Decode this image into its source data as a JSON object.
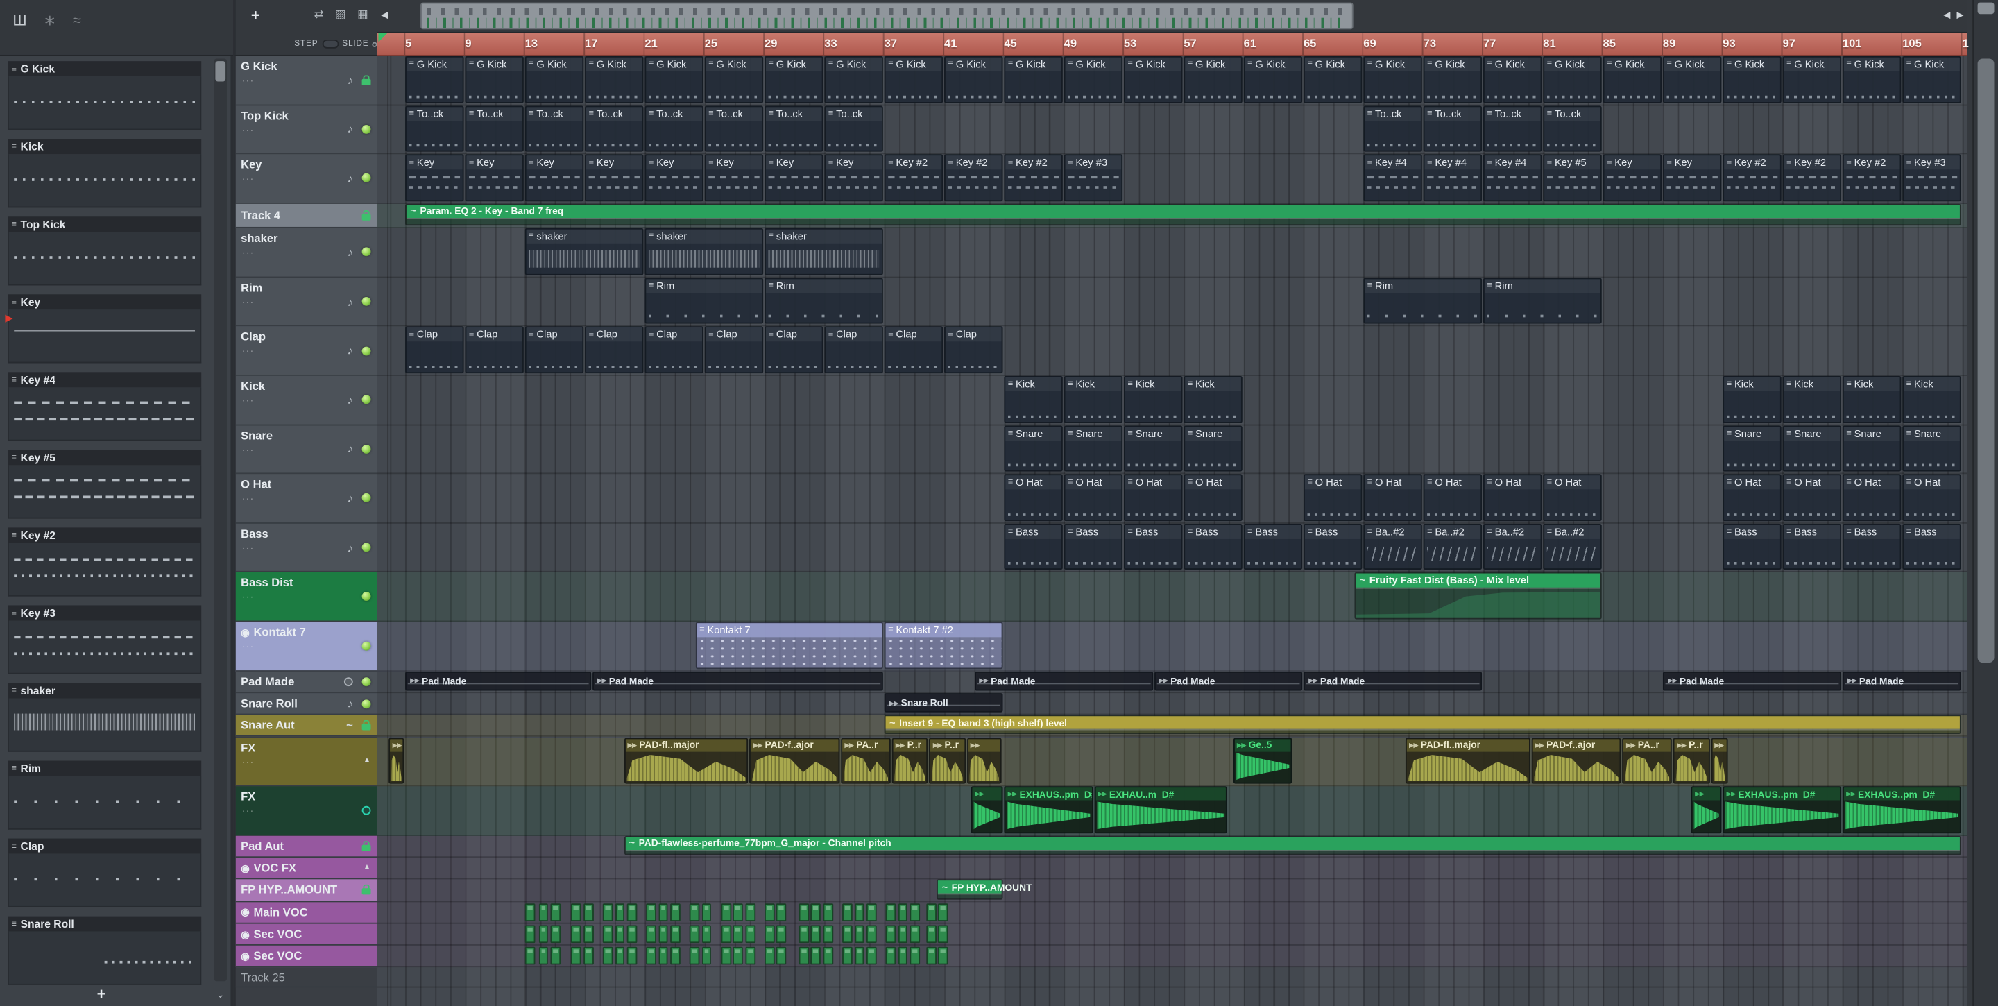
{
  "colors": {
    "row_green_bg": "#1c7c42",
    "row_lavender_bg": "#9ba1cc",
    "row_olive_bg": "#8a8238",
    "row_olive2_bg": "#6f692c",
    "row_darkgreen_bg": "#1d4130",
    "row_purple_bg": "#96589f",
    "row_purple_light_bg": "#a977b5",
    "ruler_bg": "#bc6a5f",
    "auto_green": "#2aa25d",
    "auto_olive": "#b1a33e",
    "audio_olive_wave": "#a8a84e",
    "audio_green_text": "#49e37f",
    "audio_green_wave": "#35c368",
    "led_green": "#8fd14f",
    "playhead_red": "#e0392e"
  },
  "toolbar": {
    "icons": [
      {
        "name": "playlist-grid-icon",
        "glyph": "Ш"
      },
      {
        "name": "snap-magnet-icon",
        "glyph": "∗"
      },
      {
        "name": "slide-tool-icon",
        "glyph": "≈"
      }
    ]
  },
  "panel_header": {
    "add_label": "+",
    "step_label": "STEP",
    "slide_label": "SLIDE",
    "icons": [
      {
        "name": "swap-tracks-icon",
        "glyph": "⇄"
      },
      {
        "name": "paint-tool-icon",
        "glyph": "▨"
      },
      {
        "name": "piano-view-icon",
        "glyph": "▦"
      }
    ]
  },
  "pattern_sidebar": {
    "add_label": "+",
    "patterns": [
      {
        "name": "G Kick",
        "preview": "steps"
      },
      {
        "name": "Kick",
        "preview": "steps"
      },
      {
        "name": "Top Kick",
        "preview": "steps"
      },
      {
        "name": "Key",
        "preview": "line",
        "playing": true
      },
      {
        "name": "Key #4",
        "preview": "notes"
      },
      {
        "name": "Key #5",
        "preview": "notes"
      },
      {
        "name": "Key #2",
        "preview": "notes2"
      },
      {
        "name": "Key #3",
        "preview": "notes2"
      },
      {
        "name": "shaker",
        "preview": "wave"
      },
      {
        "name": "Rim",
        "preview": "sparse"
      },
      {
        "name": "Clap",
        "preview": "sparse"
      },
      {
        "name": "Snare Roll",
        "preview": "endsteps"
      }
    ]
  },
  "track_panel": {
    "tracks": [
      {
        "name": "G Kick",
        "size": "std",
        "icons": [
          "note",
          "lock"
        ]
      },
      {
        "name": "Top Kick",
        "size": "std",
        "icons": [
          "note",
          "led"
        ]
      },
      {
        "name": "Key",
        "size": "std",
        "icons": [
          "note",
          "led"
        ]
      },
      {
        "name": "Track 4",
        "size": "sel",
        "selected": true,
        "icons": [
          "lock"
        ]
      },
      {
        "name": "shaker",
        "size": "std",
        "icons": [
          "note",
          "led"
        ]
      },
      {
        "name": "Rim",
        "size": "std",
        "icons": [
          "note",
          "led"
        ]
      },
      {
        "name": "Clap",
        "size": "std",
        "icons": [
          "note",
          "led"
        ]
      },
      {
        "name": "Kick",
        "size": "std",
        "icons": [
          "note",
          "led"
        ]
      },
      {
        "name": "Snare",
        "size": "std",
        "icons": [
          "note",
          "led"
        ]
      },
      {
        "name": "O Hat",
        "size": "std",
        "icons": [
          "note",
          "led"
        ]
      },
      {
        "name": "Bass",
        "size": "std",
        "icons": [
          "note",
          "led"
        ]
      },
      {
        "name": "Bass Dist",
        "size": "std",
        "bg": "green",
        "icons": [
          "led"
        ]
      },
      {
        "name": "Kontakt 7",
        "size": "std",
        "bg": "lavender",
        "prefix": "◉",
        "icons": [
          "led"
        ]
      },
      {
        "name": "Pad Made",
        "size": "thin",
        "icons": [
          "knob",
          "led"
        ]
      },
      {
        "name": "Snare Roll",
        "size": "thin",
        "icons": [
          "note",
          "led"
        ]
      },
      {
        "name": "Snare Aut",
        "size": "thin",
        "bg": "olive",
        "icons": [
          "link",
          "lock"
        ]
      },
      {
        "name": "FX",
        "size": "std",
        "bg": "olive2",
        "icons": [
          "tri"
        ]
      },
      {
        "name": "FX",
        "size": "std",
        "bg": "darkgreen",
        "icons": [
          "knob2"
        ]
      },
      {
        "name": "Pad Aut",
        "size": "thin",
        "bg": "purple",
        "icons": [
          "lock"
        ]
      },
      {
        "name": "VOC FX",
        "size": "thin",
        "bg": "purple",
        "prefix": "◉",
        "icons": [
          "tri"
        ]
      },
      {
        "name": "FP HYP..AMOUNT",
        "size": "thin",
        "bg": "purple_light",
        "icons": [
          "lock"
        ]
      },
      {
        "name": "Main VOC",
        "size": "thin",
        "bg": "purple",
        "prefix": "◉",
        "icons": []
      },
      {
        "name": "Sec VOC",
        "size": "thin",
        "bg": "purple",
        "prefix": "◉",
        "icons": []
      },
      {
        "name": "Sec VOC",
        "size": "thin",
        "bg": "purple",
        "prefix": "◉",
        "icons": []
      },
      {
        "name": "Track 25",
        "size": "tiny",
        "dim": true,
        "icons": []
      }
    ]
  },
  "ruler": {
    "labels": [
      5,
      9,
      13,
      17,
      21,
      25,
      29,
      33,
      37,
      41,
      45,
      49,
      53,
      57,
      61,
      65,
      69,
      73,
      77,
      81,
      85,
      89,
      93,
      97,
      101,
      105
    ],
    "clipped_label": "1"
  },
  "clips": [
    {
      "track": 0,
      "type": "pattern",
      "label": "G Kick",
      "start": 5,
      "len": 4,
      "count": 26,
      "preview": "steps"
    },
    {
      "track": 1,
      "type": "pattern",
      "label": "To..ck",
      "start": 5,
      "len": 4,
      "count": 8,
      "preview": "steps"
    },
    {
      "track": 1,
      "type": "pattern",
      "label": "To..ck",
      "start": 69,
      "len": 4,
      "count": 4,
      "preview": "steps"
    },
    {
      "track": 2,
      "type": "pattern",
      "label": "Key",
      "start": 5,
      "len": 4,
      "count": 8,
      "preview": "notes"
    },
    {
      "track": 2,
      "type": "pattern",
      "label": "Key #2",
      "start": 37,
      "len": 4,
      "count": 3,
      "preview": "notes"
    },
    {
      "track": 2,
      "type": "pattern",
      "label": "Key #3",
      "start": 49,
      "len": 4,
      "count": 1,
      "preview": "notes"
    },
    {
      "track": 2,
      "type": "pattern",
      "label": "Key #4",
      "start": 69,
      "len": 4,
      "count": 3,
      "preview": "notes"
    },
    {
      "track": 2,
      "type": "pattern",
      "label": "Key #5",
      "start": 81,
      "len": 4,
      "count": 1,
      "preview": "notes"
    },
    {
      "track": 2,
      "type": "pattern",
      "label": "Key",
      "start": 85,
      "len": 4,
      "count": 2,
      "preview": "notes"
    },
    {
      "track": 2,
      "type": "pattern",
      "label": "Key #2",
      "start": 93,
      "len": 4,
      "count": 3,
      "preview": "notes"
    },
    {
      "track": 2,
      "type": "pattern",
      "label": "Key #3",
      "start": 105,
      "len": 4,
      "count": 1,
      "preview": "notes"
    },
    {
      "track": 3,
      "type": "auto",
      "style": "green",
      "label": "Param. EQ 2 - Key - Band 7 freq",
      "start": 5,
      "len": 104
    },
    {
      "track": 4,
      "type": "pattern",
      "label": "shaker",
      "start": 13,
      "len": 8,
      "count": 3,
      "preview": "wave"
    },
    {
      "track": 5,
      "type": "pattern",
      "label": "Rim",
      "start": 21,
      "len": 8,
      "count": 2,
      "preview": "sparse"
    },
    {
      "track": 5,
      "type": "pattern",
      "label": "Rim",
      "start": 69,
      "len": 8,
      "count": 2,
      "preview": "sparse"
    },
    {
      "track": 6,
      "type": "pattern",
      "label": "Clap",
      "start": 5,
      "len": 4,
      "count": 10,
      "preview": "steps"
    },
    {
      "track": 7,
      "type": "pattern",
      "label": "Kick",
      "start": 45,
      "len": 4,
      "count": 4,
      "preview": "steps"
    },
    {
      "track": 7,
      "type": "pattern",
      "label": "Kick",
      "start": 93,
      "len": 4,
      "count": 4,
      "preview": "steps"
    },
    {
      "track": 8,
      "type": "pattern",
      "label": "Snare",
      "start": 45,
      "len": 4,
      "count": 4,
      "preview": "steps"
    },
    {
      "track": 8,
      "type": "pattern",
      "label": "Snare",
      "start": 93,
      "len": 4,
      "count": 4,
      "preview": "steps"
    },
    {
      "track": 9,
      "type": "pattern",
      "label": "O Hat",
      "start": 45,
      "len": 4,
      "count": 4,
      "preview": "steps"
    },
    {
      "track": 9,
      "type": "pattern",
      "label": "O Hat",
      "start": 65,
      "len": 4,
      "count": 5,
      "preview": "steps"
    },
    {
      "track": 9,
      "type": "pattern",
      "label": "O Hat",
      "start": 93,
      "len": 4,
      "count": 4,
      "preview": "steps"
    },
    {
      "track": 10,
      "type": "pattern",
      "label": "Bass",
      "start": 45,
      "len": 4,
      "count": 6,
      "preview": "steps"
    },
    {
      "track": 10,
      "type": "pattern",
      "label": "Ba..#2",
      "start": 69,
      "len": 4,
      "count": 4,
      "preview": "slides"
    },
    {
      "track": 10,
      "type": "pattern",
      "label": "Bass",
      "start": 93,
      "len": 4,
      "count": 4,
      "preview": "steps"
    },
    {
      "track": 11,
      "type": "auto",
      "style": "green",
      "label": "Fruity Fast Dist (Bass) - Mix level",
      "start": 68.4,
      "len": 16.6,
      "curve": "rise"
    },
    {
      "track": 12,
      "type": "kontakt",
      "label": "Kontakt 7",
      "start": 24.4,
      "len": 12.6
    },
    {
      "track": 12,
      "type": "kontakt",
      "label": "Kontakt 7 #2",
      "start": 37,
      "len": 8
    },
    {
      "track": 13,
      "type": "thin_audio",
      "label": "Pad Made",
      "start": 5,
      "len": 12.5
    },
    {
      "track": 13,
      "type": "thin_audio",
      "label": "Pad Made",
      "start": 17.5,
      "len": 19.5
    },
    {
      "track": 13,
      "type": "thin_audio",
      "label": "Pad Made",
      "start": 43,
      "len": 12
    },
    {
      "track": 13,
      "type": "thin_audio",
      "label": "Pad Made",
      "start": 55,
      "len": 10
    },
    {
      "track": 13,
      "type": "thin_audio",
      "label": "Pad Made",
      "start": 65,
      "len": 12
    },
    {
      "track": 13,
      "type": "thin_audio",
      "label": "Pad Made",
      "start": 89,
      "len": 12
    },
    {
      "track": 13,
      "type": "thin_audio",
      "label": "Pad Made",
      "start": 101,
      "len": 8
    },
    {
      "track": 14,
      "type": "thin_audio",
      "label": "Snare Roll",
      "start": 37,
      "len": 8
    },
    {
      "track": 15,
      "type": "auto",
      "style": "olive",
      "label": "Insert 9 - EQ band 3 (high shelf) level",
      "start": 37,
      "len": 72
    },
    {
      "track": 16,
      "type": "audio",
      "style": "olive",
      "label": "",
      "start": 3.9,
      "len": 1.1
    },
    {
      "track": 16,
      "type": "audio",
      "style": "olive",
      "label": "PAD-fl..major",
      "start": 19.6,
      "len": 8.4
    },
    {
      "track": 16,
      "type": "audio",
      "style": "olive",
      "label": "PAD-f..ajor",
      "start": 28,
      "len": 6.1
    },
    {
      "track": 16,
      "type": "audio",
      "style": "olive",
      "label": "PA..r",
      "start": 34.1,
      "len": 3.4
    },
    {
      "track": 16,
      "type": "audio",
      "style": "olive",
      "label": "P..r",
      "start": 37.5,
      "len": 2.5
    },
    {
      "track": 16,
      "type": "audio",
      "style": "olive",
      "label": "P..r",
      "start": 40,
      "len": 2.5
    },
    {
      "track": 16,
      "type": "audio",
      "style": "olive",
      "label": "",
      "start": 42.5,
      "len": 2.4
    },
    {
      "track": 16,
      "type": "audio",
      "style": "green",
      "label": "Ge..5",
      "start": 60.3,
      "len": 4
    },
    {
      "track": 16,
      "type": "audio",
      "style": "olive",
      "label": "PAD-fl..major",
      "start": 71.8,
      "len": 8.4
    },
    {
      "track": 16,
      "type": "audio",
      "style": "olive",
      "label": "PAD-f..ajor",
      "start": 80.2,
      "len": 6.1
    },
    {
      "track": 16,
      "type": "audio",
      "style": "olive",
      "label": "PA..r",
      "start": 86.3,
      "len": 3.4
    },
    {
      "track": 16,
      "type": "audio",
      "style": "olive",
      "label": "P..r",
      "start": 89.7,
      "len": 2.5
    },
    {
      "track": 16,
      "type": "audio",
      "style": "olive",
      "label": "",
      "start": 92.2,
      "len": 1.2
    },
    {
      "track": 17,
      "type": "audio",
      "style": "green",
      "label": "",
      "start": 42.8,
      "len": 2.2
    },
    {
      "track": 17,
      "type": "audio",
      "style": "green",
      "label": "EXHAUS..pm_D#",
      "start": 45,
      "len": 6
    },
    {
      "track": 17,
      "type": "audio",
      "style": "green",
      "label": "EXHAU..m_D#",
      "start": 51,
      "len": 9
    },
    {
      "track": 17,
      "type": "audio",
      "style": "green",
      "label": "",
      "start": 90.9,
      "len": 2.1
    },
    {
      "track": 17,
      "type": "audio",
      "style": "green",
      "label": "EXHAUS..pm_D#",
      "start": 93,
      "len": 8
    },
    {
      "track": 17,
      "type": "audio",
      "style": "green",
      "label": "EXHAUS..pm_D#",
      "start": 101,
      "len": 8
    },
    {
      "track": 18,
      "type": "auto",
      "style": "green",
      "label": "PAD-flawless-perfume_77bpm_G_major - Channel pitch",
      "start": 19.6,
      "len": 89.4
    },
    {
      "track": 20,
      "type": "auto",
      "style": "green",
      "label": "FP HYP..AMOUNT",
      "start": 40.5,
      "len": 4.5
    }
  ],
  "vocal_chops": {
    "rows": [
      21,
      22,
      23
    ],
    "len": 0.75,
    "starts": [
      13,
      13.9,
      14.7,
      16.1,
      16.9,
      18.2,
      19,
      19.8,
      21.1,
      21.9,
      22.7,
      24,
      24.8,
      26.1,
      26.9,
      27.7,
      29,
      29.8,
      31.3,
      32.1,
      32.9,
      34.2,
      35,
      35.8,
      37.1,
      37.9,
      38.7,
      39.8,
      40.6
    ]
  }
}
